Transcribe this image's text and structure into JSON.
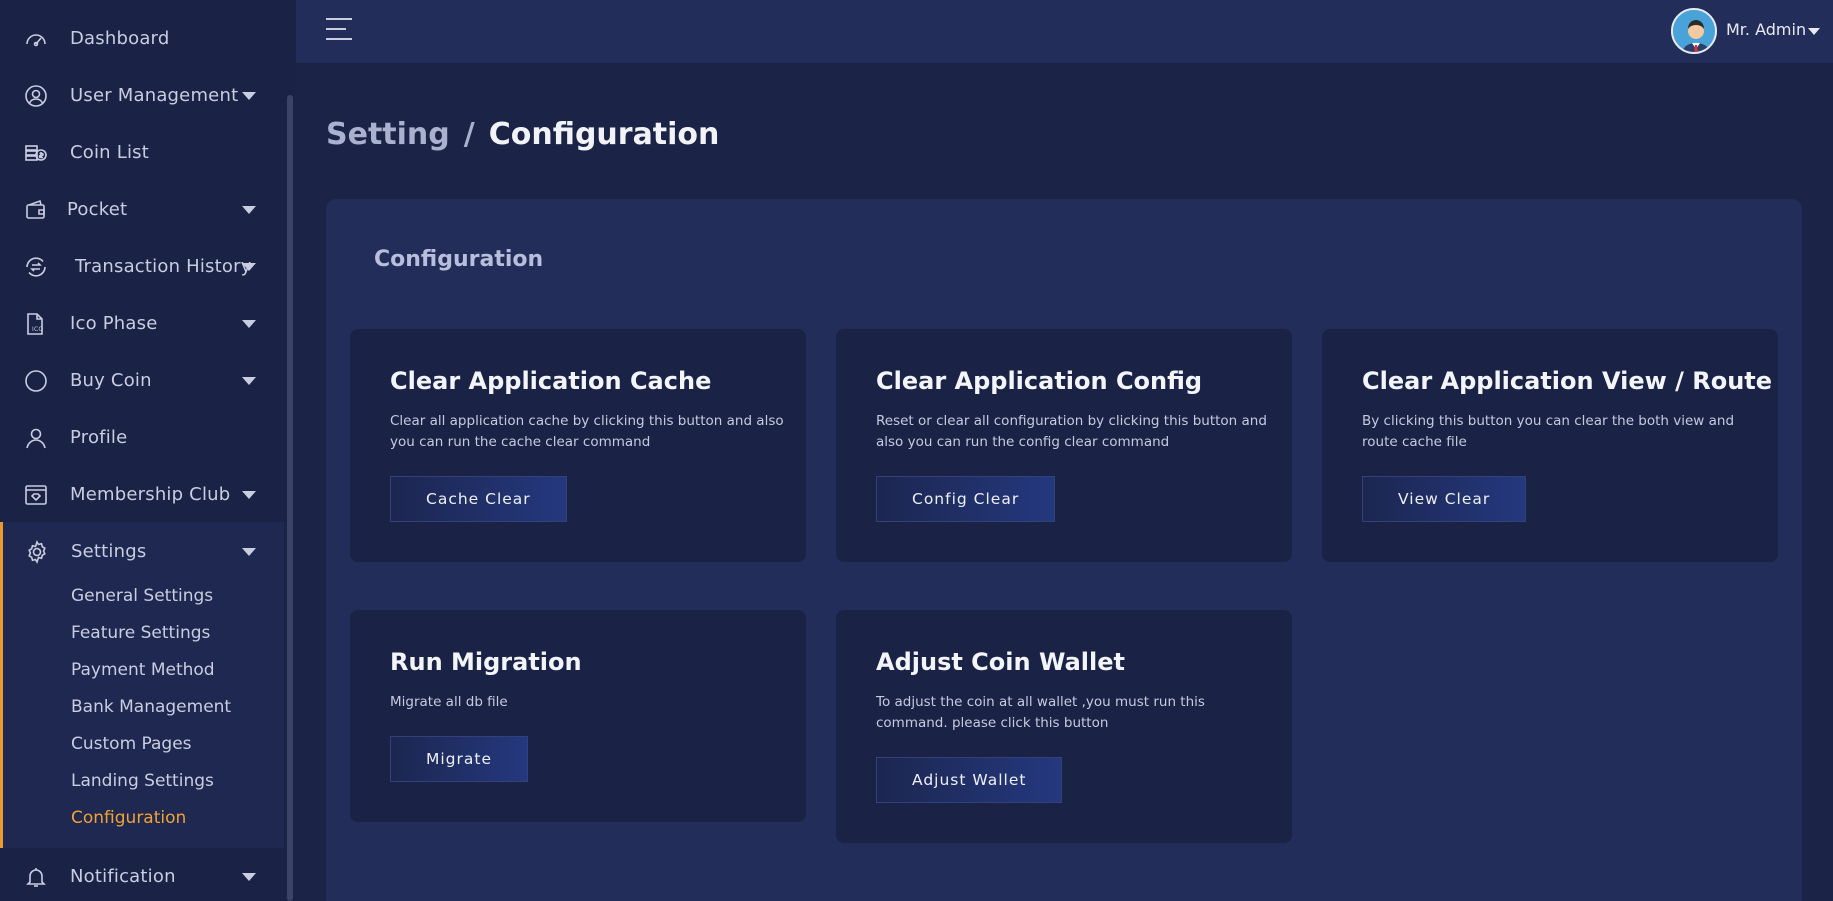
{
  "sidebar": {
    "items": [
      {
        "label": "Dashboard",
        "icon": "speedometer-icon"
      },
      {
        "label": "User Management",
        "icon": "user-circle-icon"
      },
      {
        "label": "Coin List",
        "icon": "coins-icon"
      },
      {
        "label": "Pocket",
        "icon": "wallet-icon"
      },
      {
        "label": "Transaction History",
        "icon": "transaction-icon"
      },
      {
        "label": "Ico Phase",
        "icon": "ico-file-icon"
      },
      {
        "label": "Buy Coin",
        "icon": "circle-icon"
      },
      {
        "label": "Profile",
        "icon": "user-icon"
      },
      {
        "label": "Membership Club",
        "icon": "membership-icon"
      },
      {
        "label": "Settings",
        "icon": "gear-icon"
      },
      {
        "label": "Notification",
        "icon": "bell-icon"
      }
    ],
    "settings_sub": [
      "General Settings",
      "Feature Settings",
      "Payment Method",
      "Bank Management",
      "Custom Pages",
      "Landing Settings",
      "Configuration"
    ],
    "active_sub": "Configuration"
  },
  "topbar": {
    "user_name": "Mr. Admin"
  },
  "breadcrumb": {
    "parent": "Setting",
    "separator": "/",
    "current": "Configuration"
  },
  "panel": {
    "title": "Configuration",
    "cards": [
      {
        "title": "Clear Application Cache",
        "desc": "Clear all application cache by clicking this button and also you can run the cache clear command",
        "button": "Cache Clear"
      },
      {
        "title": "Clear Application Config",
        "desc": "Reset or clear all configuration by clicking this button and also you can run the config clear command",
        "button": "Config Clear"
      },
      {
        "title": "Clear Application View / Route",
        "desc": "By clicking this button you can clear the both view and route cache file",
        "button": "View Clear"
      },
      {
        "title": "Run Migration",
        "desc": "Migrate all db file",
        "button": "Migrate"
      },
      {
        "title": "Adjust Coin Wallet",
        "desc": "To adjust the coin at all wallet ,you must run this command. please click this button",
        "button": "Adjust Wallet"
      }
    ]
  },
  "colors": {
    "background": "#1b2447",
    "panel": "#222d59",
    "card": "#1a2346",
    "accent": "#f0a236"
  }
}
